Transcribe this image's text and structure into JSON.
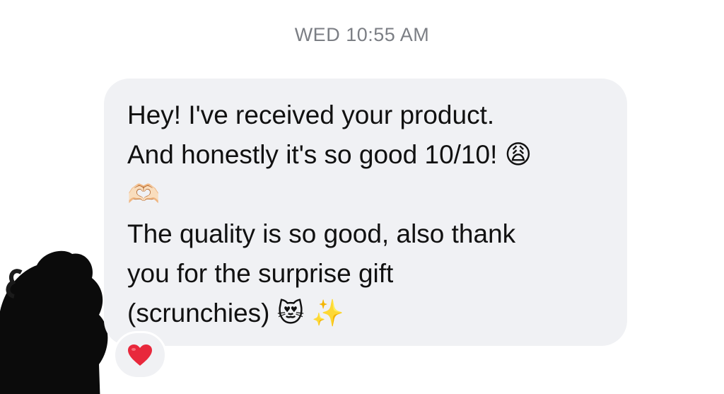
{
  "conversation": {
    "timestamp": "WED 10:55 AM"
  },
  "message": {
    "text": "Hey! I've received your product.\nAnd honestly it's so good 10/10! 😩\n🫶🏻\nThe quality is so good, also thank\nyou for the surprise gift\n(scrunchies) 😻 ✨",
    "bubble_color": "#f0f1f4",
    "text_color": "#111111"
  },
  "reaction": {
    "icon": "red-heart-icon",
    "color": "#e8283c"
  }
}
